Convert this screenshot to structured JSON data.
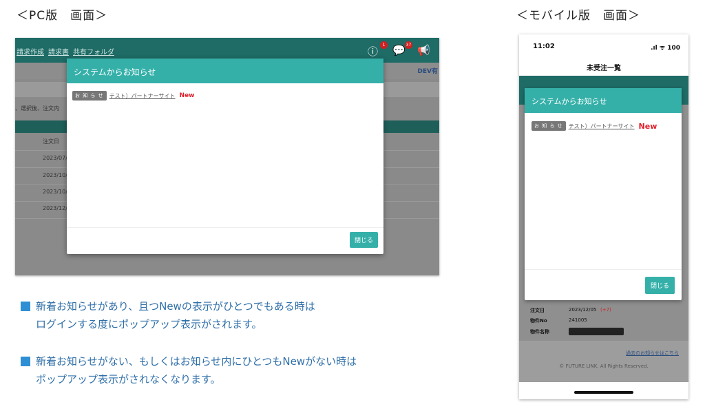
{
  "pc_section": {
    "title": "＜PC版　画面＞",
    "nav_links": [
      "請求作成",
      "請求書",
      "共有フォルダ"
    ],
    "badges": {
      "info": "1",
      "chat": "37"
    },
    "env_label": "DEV有",
    "bg_text": {
      "instruction": "、選択後、注文内",
      "col_head": "注文日",
      "dates": [
        "2023/07/",
        "2023/10/",
        "2023/10/",
        "2023/12/"
      ]
    },
    "modal": {
      "title": "システムからお知らせ",
      "tag": "お 知 ら せ",
      "link_text": "テスト）パートナーサイト",
      "new_label": "New",
      "close_label": "閉じる"
    }
  },
  "mobile_section": {
    "title": "＜モバイル版　画面＞",
    "status": {
      "time": "11:02",
      "icons": ".ıl ᯤ 100"
    },
    "page_title": "未受注一覧",
    "modal": {
      "title": "システムからお知らせ",
      "tag": "お 知 ら せ",
      "link_text": "テスト）パートナーサイト",
      "new_label": "New",
      "close_label": "閉じる"
    },
    "bg_rows": [
      {
        "label": "注文日",
        "value": "2023/12/05",
        "extra": "(+7)"
      },
      {
        "label": "物件No",
        "value": "241005",
        "extra": ""
      },
      {
        "label": "物件名称",
        "value": "",
        "extra": ""
      }
    ],
    "past_link": "過去のお知らせはこちら",
    "copyright": "© FUTURE LINK. All Rights Reserved."
  },
  "description": {
    "item1_line1": "新着お知らせがあり、且つNewの表示がひとつでもある時は",
    "item1_line2": "ログインする度にポップアップ表示がされます。",
    "item2_line1": "新着お知らせがない、もしくはお知らせ内にひとつもNewがない時は",
    "item2_line2": "ポップアップ表示がされなくなります。"
  },
  "colors": {
    "teal": "#35b0a9",
    "dark_teal": "#1f6b66",
    "new_red": "#e0202a",
    "desc_blue": "#2f6fa8"
  }
}
